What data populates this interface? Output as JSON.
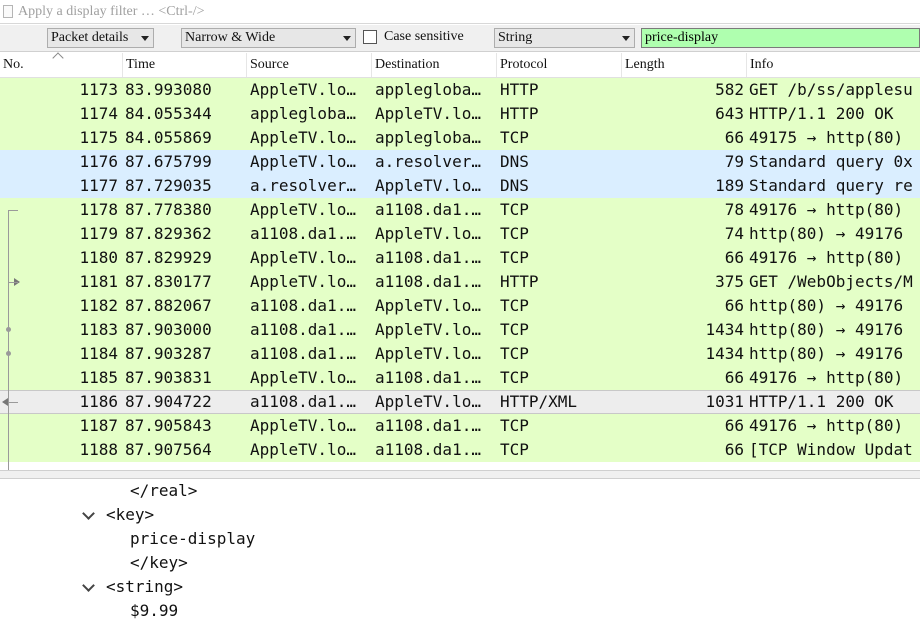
{
  "filter": {
    "placeholder": "Apply a display filter … <Ctrl-/>"
  },
  "find": {
    "scope": "Packet details",
    "charset": "Narrow & Wide",
    "case_sensitive_label": "Case sensitive",
    "case_sensitive": false,
    "search_type": "String",
    "search_text": "price-display"
  },
  "columns": [
    "No.",
    "Time",
    "Source",
    "Destination",
    "Protocol",
    "Length",
    "Info"
  ],
  "packets": [
    {
      "no": "1173",
      "time": "83.993080",
      "src": "AppleTV.lo…",
      "dst": "appleglobа…",
      "proto": "HTTP",
      "len": "582",
      "info": "GET /b/ss/applesu",
      "kind": "http"
    },
    {
      "no": "1174",
      "time": "84.055344",
      "src": "appleglobа…",
      "dst": "AppleTV.lo…",
      "proto": "HTTP",
      "len": "643",
      "info": "HTTP/1.1 200 OK",
      "kind": "http"
    },
    {
      "no": "1175",
      "time": "84.055869",
      "src": "AppleTV.lo…",
      "dst": "appleglobа…",
      "proto": "TCP",
      "len": "66",
      "info": "49175 → http(80)",
      "kind": "tcp"
    },
    {
      "no": "1176",
      "time": "87.675799",
      "src": "AppleTV.lo…",
      "dst": "a.resolver…",
      "proto": "DNS",
      "len": "79",
      "info": "Standard query 0x",
      "kind": "dns"
    },
    {
      "no": "1177",
      "time": "87.729035",
      "src": "a.resolver…",
      "dst": "AppleTV.lo…",
      "proto": "DNS",
      "len": "189",
      "info": "Standard query re",
      "kind": "dns"
    },
    {
      "no": "1178",
      "time": "87.778380",
      "src": "AppleTV.lo…",
      "dst": "a1108.da1.…",
      "proto": "TCP",
      "len": "78",
      "info": "49176 → http(80)",
      "kind": "tcp"
    },
    {
      "no": "1179",
      "time": "87.829362",
      "src": "a1108.da1.…",
      "dst": "AppleTV.lo…",
      "proto": "TCP",
      "len": "74",
      "info": "http(80) → 49176",
      "kind": "tcp"
    },
    {
      "no": "1180",
      "time": "87.829929",
      "src": "AppleTV.lo…",
      "dst": "a1108.da1.…",
      "proto": "TCP",
      "len": "66",
      "info": "49176 → http(80)",
      "kind": "tcp"
    },
    {
      "no": "1181",
      "time": "87.830177",
      "src": "AppleTV.lo…",
      "dst": "a1108.da1.…",
      "proto": "HTTP",
      "len": "375",
      "info": "GET /WebObjects/M",
      "kind": "http"
    },
    {
      "no": "1182",
      "time": "87.882067",
      "src": "a1108.da1.…",
      "dst": "AppleTV.lo…",
      "proto": "TCP",
      "len": "66",
      "info": "http(80) → 49176",
      "kind": "tcp"
    },
    {
      "no": "1183",
      "time": "87.903000",
      "src": "a1108.da1.…",
      "dst": "AppleTV.lo…",
      "proto": "TCP",
      "len": "1434",
      "info": "http(80) → 49176",
      "kind": "tcp"
    },
    {
      "no": "1184",
      "time": "87.903287",
      "src": "a1108.da1.…",
      "dst": "AppleTV.lo…",
      "proto": "TCP",
      "len": "1434",
      "info": "http(80) → 49176",
      "kind": "tcp"
    },
    {
      "no": "1185",
      "time": "87.903831",
      "src": "AppleTV.lo…",
      "dst": "a1108.da1.…",
      "proto": "TCP",
      "len": "66",
      "info": "49176 → http(80)",
      "kind": "tcp"
    },
    {
      "no": "1186",
      "time": "87.904722",
      "src": "a1108.da1.…",
      "dst": "AppleTV.lo…",
      "proto": "HTTP/XML",
      "len": "1031",
      "info": "HTTP/1.1 200 OK",
      "kind": "selected"
    },
    {
      "no": "1187",
      "time": "87.905843",
      "src": "AppleTV.lo…",
      "dst": "a1108.da1.…",
      "proto": "TCP",
      "len": "66",
      "info": "49176 → http(80)",
      "kind": "tcp"
    },
    {
      "no": "1188",
      "time": "87.907564",
      "src": "AppleTV.lo…",
      "dst": "a1108.da1.…",
      "proto": "TCP",
      "len": "66",
      "info": "[TCP Window Updat",
      "kind": "tcp"
    }
  ],
  "details": [
    {
      "indent": 130,
      "text": "</real>",
      "chev": false
    },
    {
      "indent": 106,
      "text": "<key>",
      "chev": true
    },
    {
      "indent": 130,
      "text": "price-display",
      "chev": false
    },
    {
      "indent": 130,
      "text": "</key>",
      "chev": false
    },
    {
      "indent": 106,
      "text": "<string>",
      "chev": true
    },
    {
      "indent": 130,
      "text": "$9.99",
      "chev": false
    }
  ],
  "colors": {
    "http_tcp_row": "#e4ffc7",
    "dns_row": "#daeeff",
    "selected_row": "#ededed",
    "search_match": "#afffaf"
  }
}
